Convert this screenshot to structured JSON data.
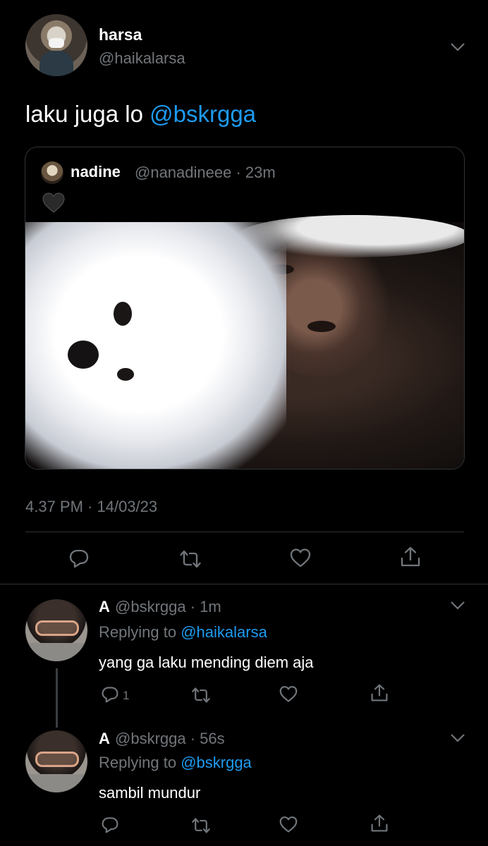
{
  "main_tweet": {
    "display_name": "harsa",
    "handle": "@haikalarsa",
    "text_prefix": "laku juga lo ",
    "text_mention": "@bskrgga",
    "timestamp": "4.37 PM · 14/03/23"
  },
  "quoted_tweet": {
    "display_name": "nadine",
    "handle_time": "@nanadineee · 23m",
    "emoji": "black-heart-icon"
  },
  "replies": [
    {
      "display_name": "A",
      "handle_time": "@bskrgga · 1m",
      "replying_prefix": "Replying to ",
      "replying_mention": "@haikalarsa",
      "text": "yang ga laku mending diem aja",
      "reply_count": "1"
    },
    {
      "display_name": "A",
      "handle_time": "@bskrgga · 56s",
      "replying_prefix": "Replying to ",
      "replying_mention": "@bskrgga",
      "text": "sambil mundur",
      "reply_count": ""
    }
  ],
  "colors": {
    "background": "#000000",
    "link": "#1d9bf0",
    "muted": "#71767b",
    "divider": "#2f3336"
  }
}
